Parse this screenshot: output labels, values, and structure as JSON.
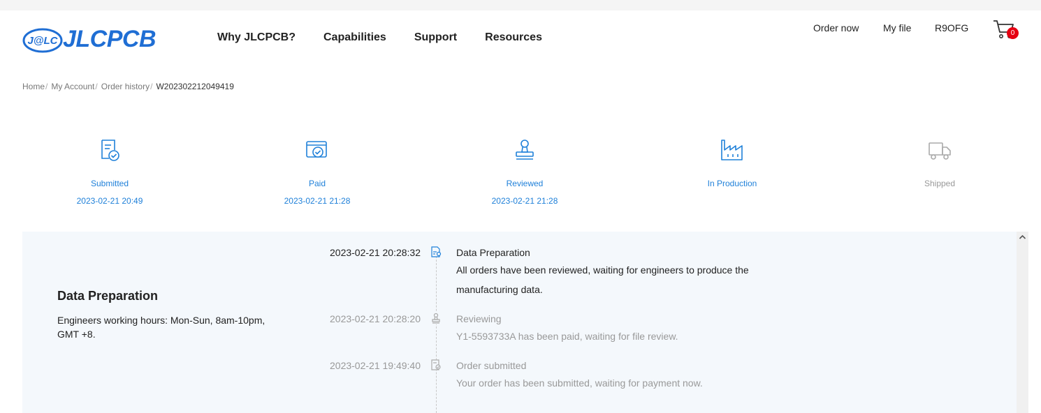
{
  "header": {
    "logo_badge": "J@LC",
    "logo_text": "JLCPCB",
    "nav": [
      "Why JLCPCB?",
      "Capabilities",
      "Support",
      "Resources"
    ],
    "right_links": {
      "order_now": "Order now",
      "my_file": "My file",
      "user": "R9OFG"
    },
    "cart_count": "0"
  },
  "breadcrumb": {
    "items": [
      "Home",
      "My Account",
      "Order history"
    ],
    "current": "W202302212049419"
  },
  "steps": [
    {
      "label": "Submitted",
      "time": "2023-02-21 20:49",
      "state": "done"
    },
    {
      "label": "Paid",
      "time": "2023-02-21 21:28",
      "state": "done"
    },
    {
      "label": "Reviewed",
      "time": "2023-02-21 21:28",
      "state": "done"
    },
    {
      "label": "In Production",
      "time": "",
      "state": "current"
    },
    {
      "label": "Shipped",
      "time": "",
      "state": "pending"
    }
  ],
  "status_panel": {
    "title": "Data Preparation",
    "description": "Engineers working hours: Mon-Sun, 8am-10pm, GMT +8.",
    "timeline": [
      {
        "time": "2023-02-21 20:28:32",
        "title": "Data Preparation",
        "text": "All orders have been reviewed, waiting for engineers to produce the manufacturing data.",
        "active": true,
        "icon": "data-prep-icon"
      },
      {
        "time": "2023-02-21 20:28:20",
        "title": "Reviewing",
        "text": "Y1-5593733A has been paid, waiting for file review.",
        "active": false,
        "icon": "reviewer-icon"
      },
      {
        "time": "2023-02-21 19:49:40",
        "title": "Order submitted",
        "text": "Your order has been submitted, waiting for payment now.",
        "active": false,
        "icon": "order-doc-icon"
      }
    ]
  },
  "colors": {
    "accent": "#1f80d9",
    "brand": "#1f6ed4",
    "badge": "#e60012",
    "panel_bg": "#f4f8fc"
  }
}
